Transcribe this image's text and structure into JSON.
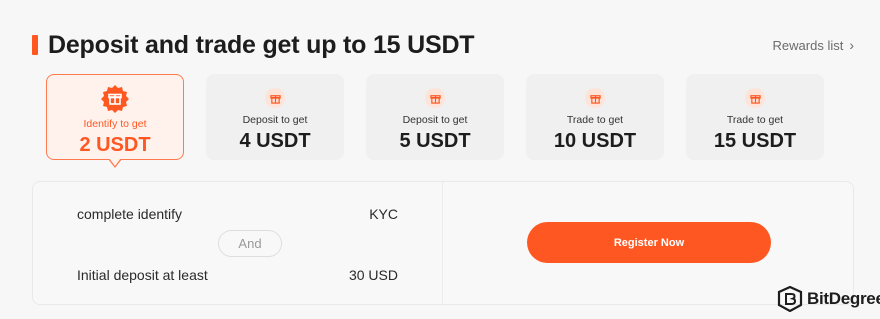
{
  "header": {
    "title": "Deposit and trade get up to 15 USDT",
    "rewards_label": "Rewards list",
    "chevron_icon": "chevron-right-icon"
  },
  "tiers": [
    {
      "label": "Identify to get",
      "amount": "2 USDT",
      "active": true
    },
    {
      "label": "Deposit to get",
      "amount": "4 USDT",
      "active": false
    },
    {
      "label": "Deposit to get",
      "amount": "5 USDT",
      "active": false
    },
    {
      "label": "Trade to get",
      "amount": "10 USDT",
      "active": false
    },
    {
      "label": "Trade to get",
      "amount": "15 USDT",
      "active": false
    }
  ],
  "requirements": {
    "row1": {
      "label": "complete identify",
      "value": "KYC"
    },
    "conjunction": "And",
    "row2": {
      "label": "Initial deposit at least",
      "value": "30 USD"
    }
  },
  "cta": {
    "label": "Register Now"
  },
  "watermark": {
    "name": "BitDegree"
  },
  "colors": {
    "accent": "#ff5722",
    "active_bg": "#fff2ec",
    "card_bg": "#f0f0f0"
  }
}
